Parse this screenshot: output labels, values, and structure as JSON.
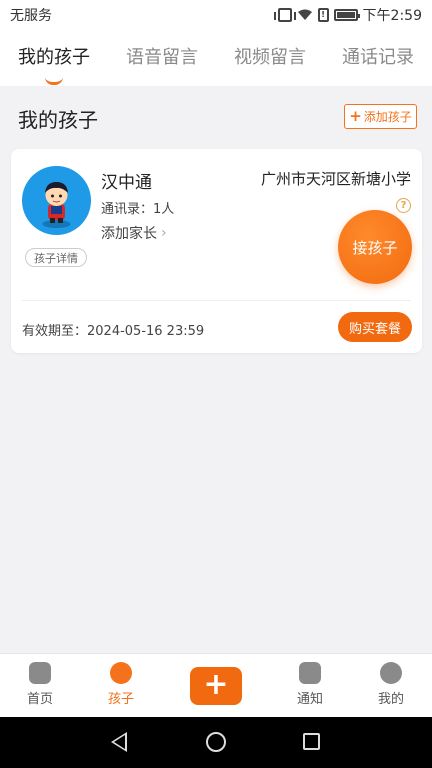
{
  "status_bar": {
    "carrier": "无服务",
    "time": "下午2:59"
  },
  "tabs": [
    {
      "label": "我的孩子",
      "active": true
    },
    {
      "label": "语音留言",
      "active": false
    },
    {
      "label": "视频留言",
      "active": false
    },
    {
      "label": "通话记录",
      "active": false
    }
  ],
  "section": {
    "title": "我的孩子",
    "add_child_label": "添加孩子"
  },
  "child_card": {
    "name": "汉中通",
    "school": "广州市天河区新塘小学",
    "contacts": "通讯录：1人",
    "add_parent": "添加家长",
    "detail_label": "孩子详情",
    "help_symbol": "?",
    "pickup_label": "接孩子",
    "validity": "有效期至：2024-05-16 23:59",
    "buy_label": "购买套餐"
  },
  "bottom_nav": [
    {
      "label": "首页",
      "icon": "home-icon",
      "active": false
    },
    {
      "label": "孩子",
      "icon": "child-icon",
      "active": true
    },
    {
      "label": "通知",
      "icon": "notification-icon",
      "active": false
    },
    {
      "label": "我的",
      "icon": "profile-icon",
      "active": false
    }
  ],
  "fab_symbol": "+",
  "colors": {
    "accent": "#f26a10",
    "avatar_bg": "#1e9ae6",
    "background": "#f2f2f4"
  }
}
